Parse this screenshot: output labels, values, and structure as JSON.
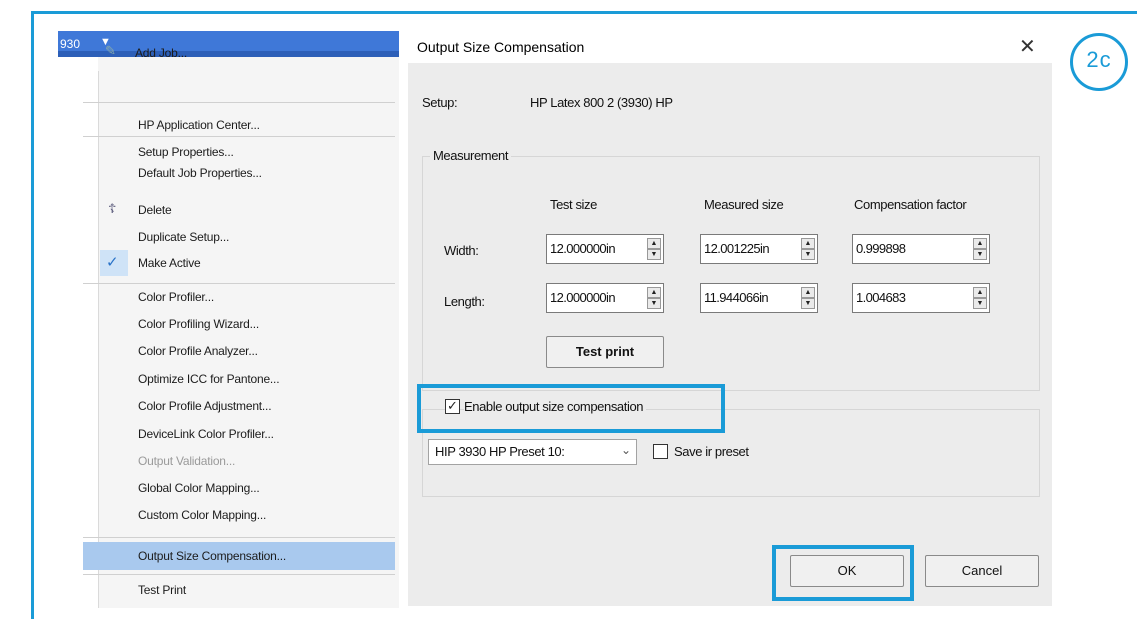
{
  "badge": {
    "label": "2c"
  },
  "menu": {
    "title_text": "930",
    "items": [
      {
        "label": "Add Job..."
      },
      {
        "label": "HP Application Center..."
      },
      {
        "label": "Setup Properties..."
      },
      {
        "label": "Default Job Properties..."
      },
      {
        "label": "Delete"
      },
      {
        "label": "Duplicate Setup..."
      },
      {
        "label": "Make Active"
      },
      {
        "label": "Color Profiler..."
      },
      {
        "label": "Color Profiling Wizard..."
      },
      {
        "label": "Color Profile Analyzer..."
      },
      {
        "label": "Optimize ICC for Pantone..."
      },
      {
        "label": "Color Profile Adjustment..."
      },
      {
        "label": "DeviceLink Color Profiler..."
      },
      {
        "label": "Output Validation..."
      },
      {
        "label": "Global Color Mapping..."
      },
      {
        "label": "Custom Color Mapping..."
      },
      {
        "label": "Output Size Compensation..."
      },
      {
        "label": "Test Print"
      }
    ]
  },
  "dialog": {
    "title": "Output Size Compensation",
    "setup_label": "Setup:",
    "setup_value": "HP Latex 800 2 (3930) HP",
    "measurement_label": "Measurement",
    "col_test": "Test size",
    "col_measured": "Measured size",
    "col_factor": "Compensation factor",
    "width_label": "Width:",
    "length_label": "Length:",
    "width": {
      "test": "12.000000in",
      "measured": "12.001225in",
      "factor": "0.999898"
    },
    "length": {
      "test": "12.000000in",
      "measured": "11.944066in",
      "factor": "1.004683"
    },
    "test_print": "Test print",
    "enable_label": "Enable output size compensation",
    "enable_checked": true,
    "preset_value": "HIP 3930 HP Preset 10:",
    "save_label": "Save ir preset",
    "save_checked": false,
    "ok": "OK",
    "cancel": "Cancel"
  },
  "colors": {
    "accent": "#1a9bd7",
    "menu_title": "#3f78d8",
    "menu_highlight": "#a9c9ee"
  }
}
